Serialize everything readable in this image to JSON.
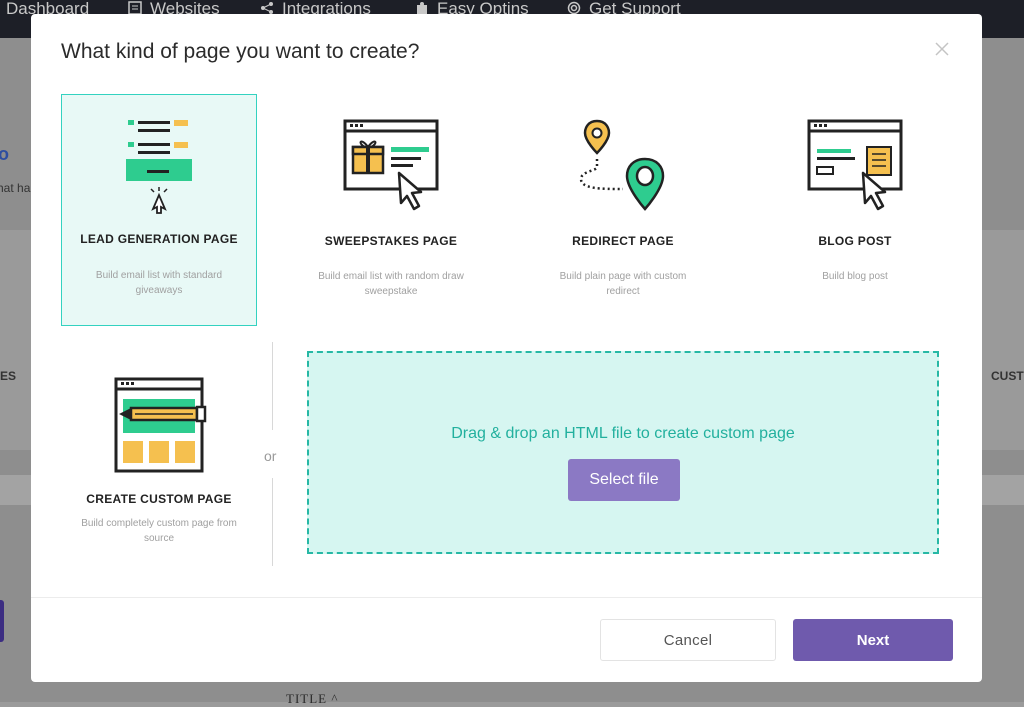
{
  "nav": {
    "items": [
      {
        "label": "Dashboard",
        "icon": "dashboard-icon"
      },
      {
        "label": "Websites",
        "icon": "websites-icon"
      },
      {
        "label": "Integrations",
        "icon": "share-icon"
      },
      {
        "label": "Easy Optins",
        "icon": "puzzle-icon"
      },
      {
        "label": "Get Support",
        "icon": "lifebuoy-icon"
      }
    ]
  },
  "background": {
    "left_label_1": "o",
    "left_label_2": "hat ha",
    "left_label_3": "ES",
    "right_label": "CUST",
    "column_title": "TITLE ^"
  },
  "modal": {
    "title": "What kind of page you want to create?",
    "cards": [
      {
        "title": "LEAD GENERATION PAGE",
        "description": "Build email list with standard giveaways",
        "icon": "lead-generation-icon",
        "selected": true
      },
      {
        "title": "SWEEPSTAKES PAGE",
        "description": "Build email list with random draw sweepstake",
        "icon": "sweepstakes-icon",
        "selected": false
      },
      {
        "title": "REDIRECT PAGE",
        "description": "Build plain page with custom redirect",
        "icon": "redirect-icon",
        "selected": false
      },
      {
        "title": "BLOG POST",
        "description": "Build blog post",
        "icon": "blog-post-icon",
        "selected": false
      },
      {
        "title": "CREATE CUSTOM PAGE",
        "description": "Build completely custom page from source",
        "icon": "custom-page-icon",
        "selected": false
      }
    ],
    "or_label": "or",
    "dropzone": {
      "text": "Drag & drop an HTML file to create custom page",
      "button_label": "Select file"
    },
    "cancel_label": "Cancel",
    "next_label": "Next"
  },
  "colors": {
    "accent_teal": "#33d2c0",
    "primary_purple": "#6f5aad",
    "select_file_purple": "#8b79c4",
    "icon_yellow": "#f5c04f",
    "icon_green": "#2ecc8f"
  }
}
